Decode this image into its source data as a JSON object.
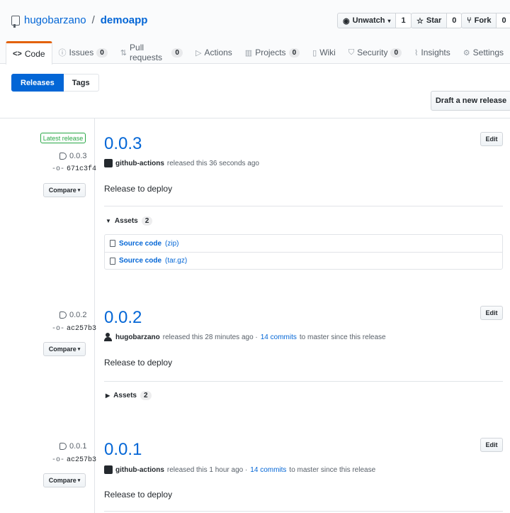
{
  "repo": {
    "owner": "hugobarzano",
    "name": "demoapp"
  },
  "actions": {
    "watch_label": "Unwatch",
    "watch_count": "1",
    "star_label": "Star",
    "star_count": "0",
    "fork_label": "Fork",
    "fork_count": "0"
  },
  "tabs": [
    {
      "label": "Code",
      "icon": "code-icon",
      "counter": ""
    },
    {
      "label": "Issues",
      "icon": "issue-icon",
      "counter": "0"
    },
    {
      "label": "Pull requests",
      "icon": "pull-request-icon",
      "counter": "0"
    },
    {
      "label": "Actions",
      "icon": "play-icon",
      "counter": ""
    },
    {
      "label": "Projects",
      "icon": "project-icon",
      "counter": "0"
    },
    {
      "label": "Wiki",
      "icon": "book-icon",
      "counter": ""
    },
    {
      "label": "Security",
      "icon": "shield-icon",
      "counter": "0"
    },
    {
      "label": "Insights",
      "icon": "graph-icon",
      "counter": ""
    },
    {
      "label": "Settings",
      "icon": "gear-icon",
      "counter": ""
    }
  ],
  "subnav": {
    "releases": "Releases",
    "tags": "Tags"
  },
  "draft_button": "Draft a new release",
  "latest_label": "Latest release",
  "compare_label": "Compare",
  "edit_label": "Edit",
  "assets_label": "Assets",
  "releases": [
    {
      "tag": "0.0.3",
      "commit": "671c3f4",
      "title": "0.0.3",
      "author": "github-actions",
      "released": "released this 36 seconds ago",
      "commits_link": "",
      "commits_suffix": "",
      "description": "Release to deploy",
      "assets_count": "2",
      "assets": [
        {
          "name": "Source code",
          "ext": "(zip)"
        },
        {
          "name": "Source code",
          "ext": "(tar.gz)"
        }
      ]
    },
    {
      "tag": "0.0.2",
      "commit": "ac257b3",
      "title": "0.0.2",
      "author": "hugobarzano",
      "released": "released this 28 minutes ago ·",
      "commits_link": "14 commits",
      "commits_suffix": "to master since this release",
      "description": "Release to deploy",
      "assets_count": "2"
    },
    {
      "tag": "0.0.1",
      "commit": "ac257b3",
      "title": "0.0.1",
      "author": "github-actions",
      "released": "released this 1 hour ago ·",
      "commits_link": "14 commits",
      "commits_suffix": "to master since this release",
      "description": "Release to deploy"
    }
  ]
}
